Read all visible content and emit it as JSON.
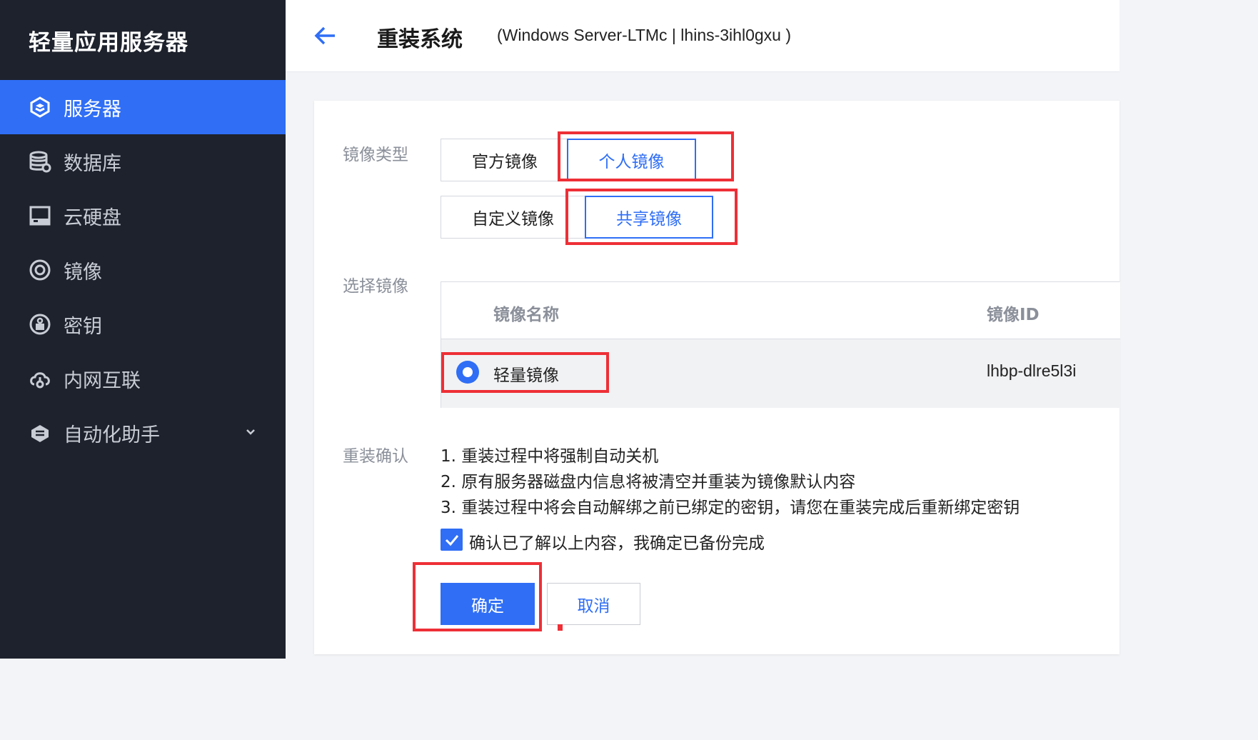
{
  "sidebar": {
    "brand": "轻量应用服务器",
    "items": [
      {
        "label": "服务器",
        "icon": "server-icon",
        "active": true
      },
      {
        "label": "数据库",
        "icon": "database-icon"
      },
      {
        "label": "云硬盘",
        "icon": "disk-icon"
      },
      {
        "label": "镜像",
        "icon": "image-icon"
      },
      {
        "label": "密钥",
        "icon": "key-icon"
      },
      {
        "label": "内网互联",
        "icon": "network-icon"
      },
      {
        "label": "自动化助手",
        "icon": "automation-icon",
        "expandable": true
      }
    ]
  },
  "header": {
    "title": "重装系统",
    "subtitle": "(Windows Server-LTMc | lhins-3ihl0gxu )"
  },
  "form": {
    "image_type_label": "镜像类型",
    "image_type_options": [
      {
        "label": "官方镜像",
        "selected": false
      },
      {
        "label": "个人镜像",
        "selected": true
      },
      {
        "label": "自定义镜像",
        "selected": false
      },
      {
        "label": "共享镜像",
        "selected": true
      }
    ],
    "select_image_label": "选择镜像",
    "table": {
      "columns": [
        "镜像名称",
        "镜像ID"
      ],
      "rows": [
        {
          "name": "轻量镜像",
          "id": "lhbp-dlre5l3i",
          "selected": true
        }
      ]
    },
    "reinstall_confirm_label": "重装确认",
    "confirm_items": [
      "1. 重装过程中将强制自动关机",
      "2. 原有服务器磁盘内信息将被清空并重装为镜像默认内容",
      "3. 重装过程中将会自动解绑之前已绑定的密钥，请您在重装完成后重新绑定密钥"
    ],
    "acknowledge": {
      "label": "确认已了解以上内容，我确定已备份完成",
      "checked": true
    },
    "confirm_button": "确定",
    "cancel_button": "取消"
  },
  "colors": {
    "sidebar_bg": "#1e222d",
    "accent": "#2f6ef5",
    "highlight": "#ee2f36"
  }
}
